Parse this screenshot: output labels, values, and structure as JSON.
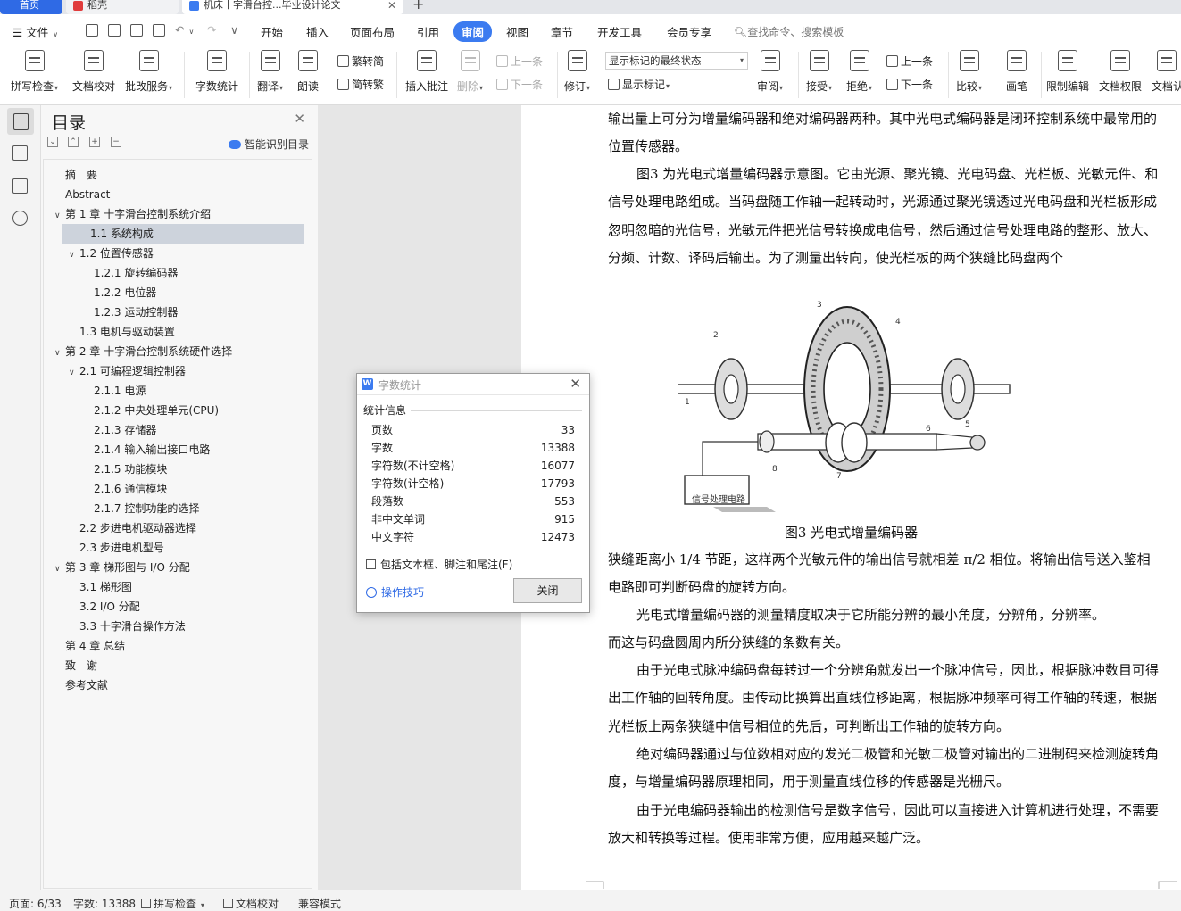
{
  "tabs": {
    "home": "首页",
    "t2": "稻壳",
    "t3": "机床十字滑台控...毕业设计论文",
    "close": "✕",
    "add": "+"
  },
  "menu": {
    "file": "文件",
    "items": [
      "开始",
      "插入",
      "页面布局",
      "引用",
      "审阅",
      "视图",
      "章节",
      "开发工具",
      "会员专享"
    ],
    "active": "审阅",
    "search": "查找命令、搜索模板"
  },
  "ribbon": {
    "spellcheck": "拼写检查",
    "doc_check": "文档校对",
    "batch": "批改服务",
    "word_count": "字数统计",
    "translate": "翻译",
    "read": "朗读",
    "to_trad": "繁转简",
    "to_simp": "简转繁",
    "insert_comment": "插入批注",
    "delete": "删除",
    "prev": "上一条",
    "next": "下一条",
    "revise": "修订",
    "markup_state": "显示标记的最终状态",
    "show_markup": "显示标记",
    "review": "审阅",
    "accept": "接受",
    "reject": "拒绝",
    "prev2": "上一条",
    "next2": "下一条",
    "compare": "比较",
    "pen": "画笔",
    "restrict": "限制编辑",
    "permission": "文档权限",
    "doc_auth": "文档认"
  },
  "toc": {
    "title": "目录",
    "smart": "智能识别目录",
    "items": [
      {
        "text": "摘　要",
        "level": 0,
        "toggle": ""
      },
      {
        "text": "Abstract",
        "level": 0,
        "toggle": ""
      },
      {
        "text": "第 1 章  十字滑台控制系统介绍",
        "level": 0,
        "toggle": "∨"
      },
      {
        "text": "1.1 系统构成",
        "level": 1,
        "toggle": "",
        "selected": true
      },
      {
        "text": "1.2 位置传感器",
        "level": 1,
        "toggle": "∨"
      },
      {
        "text": "1.2.1 旋转编码器",
        "level": 2,
        "toggle": ""
      },
      {
        "text": "1.2.2 电位器",
        "level": 2,
        "toggle": ""
      },
      {
        "text": "1.2.3 运动控制器",
        "level": 2,
        "toggle": ""
      },
      {
        "text": "1.3 电机与驱动装置",
        "level": 1,
        "toggle": ""
      },
      {
        "text": "第 2 章  十字滑台控制系统硬件选择",
        "level": 0,
        "toggle": "∨"
      },
      {
        "text": "2.1 可编程逻辑控制器",
        "level": 1,
        "toggle": "∨"
      },
      {
        "text": "2.1.1 电源",
        "level": 2,
        "toggle": ""
      },
      {
        "text": "2.1.2 中央处理单元(CPU)",
        "level": 2,
        "toggle": ""
      },
      {
        "text": "2.1.3 存储器",
        "level": 2,
        "toggle": ""
      },
      {
        "text": "2.1.4 输入输出接口电路",
        "level": 2,
        "toggle": ""
      },
      {
        "text": "2.1.5 功能模块",
        "level": 2,
        "toggle": ""
      },
      {
        "text": "2.1.6 通信模块",
        "level": 2,
        "toggle": ""
      },
      {
        "text": "2.1.7 控制功能的选择",
        "level": 2,
        "toggle": ""
      },
      {
        "text": "2.2 步进电机驱动器选择",
        "level": 1,
        "toggle": ""
      },
      {
        "text": "2.3 步进电机型号",
        "level": 1,
        "toggle": ""
      },
      {
        "text": "第 3 章  梯形图与 I/O 分配",
        "level": 0,
        "toggle": "∨"
      },
      {
        "text": "3.1 梯形图",
        "level": 1,
        "toggle": ""
      },
      {
        "text": "3.2 I/O 分配",
        "level": 1,
        "toggle": ""
      },
      {
        "text": "3.3 十字滑台操作方法",
        "level": 1,
        "toggle": ""
      },
      {
        "text": "第 4 章  总结",
        "level": 0,
        "toggle": ""
      },
      {
        "text": "致　谢",
        "level": 0,
        "toggle": ""
      },
      {
        "text": "参考文献",
        "level": 0,
        "toggle": ""
      }
    ]
  },
  "doc": {
    "paras": [
      {
        "text": "输出量上可分为增量编码器和绝对编码器两种。其中光电式编码器是闭环控制系统中最常用的位置传感器。",
        "indent": false
      },
      {
        "text": "图3 为光电式增量编码器示意图。它由光源、聚光镜、光电码盘、光栏板、光敏元件、和信号处理电路组成。当码盘随工作轴一起转动时，光源通过聚光镜透过光电码盘和光栏板形成忽明忽暗的光信号，光敏元件把光信号转换成电信号，然后通过信号处理电路的整形、放大、分频、计数、译码后输出。为了测量出转向，使光栏板的两个狭缝比码盘两个",
        "indent": true
      },
      {
        "text": "狭缝距离小 1/4 节距，这样两个光敏元件的输出信号就相差  π/2 相位。将输出信号送入鉴相电路即可判断码盘的旋转方向。",
        "indent": false
      },
      {
        "text": "光电式增量编码器的测量精度取决于它所能分辨的最小角度，分辨角，分辨率。",
        "indent": true
      },
      {
        "text": "而这与码盘圆周内所分狭缝的条数有关。",
        "indent": false
      },
      {
        "text": "由于光电式脉冲编码盘每转过一个分辨角就发出一个脉冲信号，因此，根据脉冲数目可得出工作轴的回转角度。由传动比换算出直线位移距离，根据脉冲频率可得工作轴的转速，根据光栏板上两条狭缝中信号相位的先后，可判断出工作轴的旋转方向。",
        "indent": true
      },
      {
        "text": "绝对编码器通过与位数相对应的发光二极管和光敏二极管对输出的二进制码来检测旋转角度，与增量编码器原理相同，用于测量直线位移的传感器是光栅尺。",
        "indent": true
      },
      {
        "text": "由于光电编码器输出的检测信号是数字信号，因此可以直接进入计算机进行处理，不需要放大和转换等过程。使用非常方便，应用越来越广泛。",
        "indent": true
      }
    ],
    "figure_caption": "图3  光电式增量编码器",
    "figure_labels": [
      "1",
      "2",
      "3",
      "4",
      "5",
      "6",
      "7",
      "8"
    ],
    "figure_box_label": "信号处理电路"
  },
  "dialog": {
    "logo": "W",
    "title": "字数统计",
    "group": "统计信息",
    "stats": [
      {
        "label": "页数",
        "value": "33"
      },
      {
        "label": "字数",
        "value": "13388"
      },
      {
        "label": "字符数(不计空格)",
        "value": "16077"
      },
      {
        "label": "字符数(计空格)",
        "value": "17793"
      },
      {
        "label": "段落数",
        "value": "553"
      },
      {
        "label": "非中文单词",
        "value": "915"
      },
      {
        "label": "中文字符",
        "value": "12473"
      }
    ],
    "include": "包括文本框、脚注和尾注(F)",
    "tips": "操作技巧",
    "close": "关闭"
  },
  "status": {
    "page": "页面: 6/33",
    "words": "字数: 13388",
    "spell": "拼写检查",
    "proof": "文档校对",
    "compat": "兼容模式"
  },
  "colors": {
    "accent": "#3b7bf0",
    "selected": "#cdd3dc"
  }
}
